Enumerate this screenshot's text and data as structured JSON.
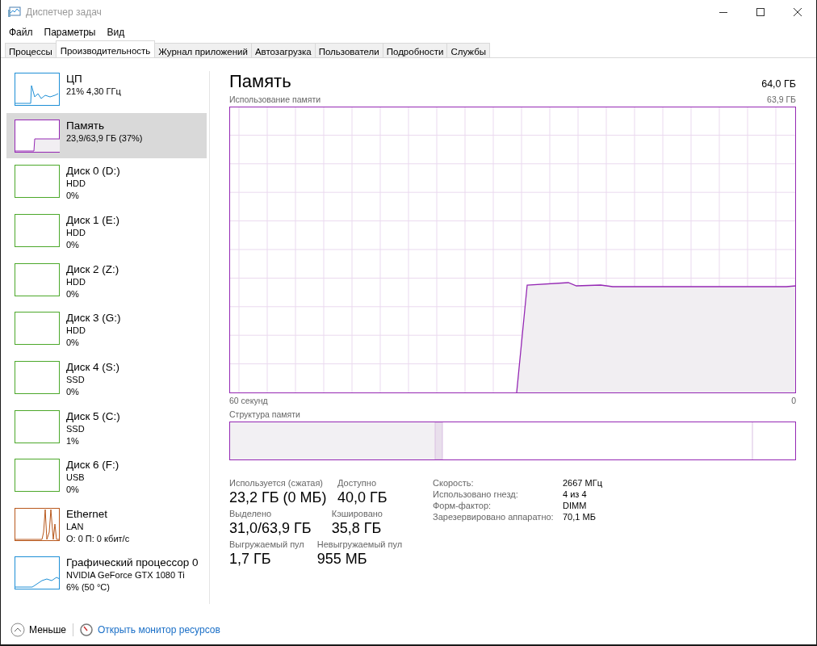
{
  "window": {
    "title": "Диспетчер задач"
  },
  "menu": [
    "Файл",
    "Параметры",
    "Вид"
  ],
  "tabs": [
    {
      "label": "Процессы",
      "selected": false
    },
    {
      "label": "Производительность",
      "selected": true
    },
    {
      "label": "Журнал приложений",
      "selected": false
    },
    {
      "label": "Автозагрузка",
      "selected": false
    },
    {
      "label": "Пользователи",
      "selected": false
    },
    {
      "label": "Подробности",
      "selected": false
    },
    {
      "label": "Службы",
      "selected": false
    }
  ],
  "sidebar": {
    "items": [
      {
        "kind": "cpu",
        "name": "ЦП",
        "lines": [
          "21% 4,30 ГГц"
        ],
        "selected": false
      },
      {
        "kind": "memory",
        "name": "Память",
        "lines": [
          "23,9/63,9 ГБ (37%)"
        ],
        "selected": true
      },
      {
        "kind": "disk",
        "name": "Диск 0 (D:)",
        "lines": [
          "HDD",
          "0%"
        ],
        "selected": false
      },
      {
        "kind": "disk",
        "name": "Диск 1 (E:)",
        "lines": [
          "HDD",
          "0%"
        ],
        "selected": false
      },
      {
        "kind": "disk",
        "name": "Диск 2 (Z:)",
        "lines": [
          "HDD",
          "0%"
        ],
        "selected": false
      },
      {
        "kind": "disk",
        "name": "Диск 3 (G:)",
        "lines": [
          "HDD",
          "0%"
        ],
        "selected": false
      },
      {
        "kind": "disk",
        "name": "Диск 4 (S:)",
        "lines": [
          "SSD",
          "0%"
        ],
        "selected": false
      },
      {
        "kind": "disk",
        "name": "Диск 5 (C:)",
        "lines": [
          "SSD",
          "1%"
        ],
        "selected": false
      },
      {
        "kind": "disk",
        "name": "Диск 6 (F:)",
        "lines": [
          "USB",
          "0%"
        ],
        "selected": false
      },
      {
        "kind": "network",
        "name": "Ethernet",
        "lines": [
          "LAN",
          "О: 0 П: 0 кбит/с"
        ],
        "selected": false
      },
      {
        "kind": "gpu",
        "name": "Графический процессор 0",
        "lines": [
          "NVIDIA GeForce GTX 1080 Ti",
          "6%  (50 °C)"
        ],
        "selected": false
      }
    ]
  },
  "main": {
    "title": "Память",
    "total": "64,0 ГБ",
    "chart_label": "Использование памяти",
    "chart_max": "63,9 ГБ",
    "x_start": "60 секунд",
    "x_end": "0",
    "composition_label": "Структура памяти",
    "stats": [
      [
        {
          "label": "Используется (сжатая)",
          "value": "23,2 ГБ (0 МБ)"
        },
        {
          "label": "Доступно",
          "value": "40,0 ГБ"
        }
      ],
      [
        {
          "label": "Выделено",
          "value": "31,0/63,9 ГБ"
        },
        {
          "label": "Кэшировано",
          "value": "35,8 ГБ"
        }
      ],
      [
        {
          "label": "Выгружаемый пул",
          "value": "1,7 ГБ"
        },
        {
          "label": "Невыгружаемый пул",
          "value": "955 МБ"
        }
      ]
    ],
    "specs": [
      {
        "label": "Скорость:",
        "value": "2667 МГц"
      },
      {
        "label": "Использовано гнезд:",
        "value": "4 из 4"
      },
      {
        "label": "Форм-фактор:",
        "value": "DIMM"
      },
      {
        "label": "Зарезервировано аппаратно:",
        "value": "70,1 МБ"
      }
    ]
  },
  "footer": {
    "less": "Меньше",
    "link": "Открыть монитор ресурсов"
  }
}
